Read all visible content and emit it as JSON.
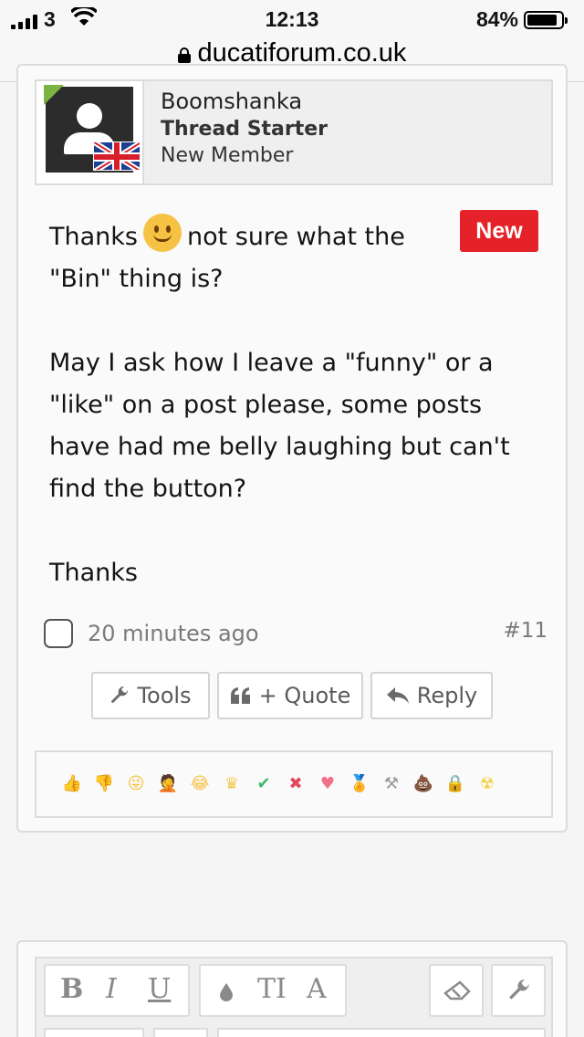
{
  "status_bar": {
    "carrier": "3",
    "time": "12:13",
    "battery": "84%"
  },
  "url_bar": {
    "domain": "ducatiforum.co.uk"
  },
  "post": {
    "author": {
      "name": "Boomshanka",
      "badge": "Thread Starter",
      "role": "New Member"
    },
    "new_badge": "New",
    "message": {
      "line1_before": "Thanks",
      "line1_after": "not sure what the",
      "line2": "\"Bin\" thing is?",
      "para2": [
        "May I ask how I leave a \"funny\" or a",
        "\"like\" on a post please, some posts",
        "have had me belly laughing but can't",
        "find the button?"
      ],
      "closing": "Thanks"
    },
    "timestamp": "20 minutes ago",
    "post_number": "#11",
    "actions": {
      "tools": "Tools",
      "quote": "+ Quote",
      "reply": "Reply"
    },
    "reactions": [
      {
        "name": "like",
        "glyph": "👍",
        "color": "#f3c9a4"
      },
      {
        "name": "dislike",
        "glyph": "👎",
        "color": "#f3c9a4"
      },
      {
        "name": "funny",
        "glyph": "😜",
        "color": "#f6c244"
      },
      {
        "name": "facepalm",
        "glyph": "🤦",
        "color": "#e8b79a"
      },
      {
        "name": "laugh",
        "glyph": "😂",
        "color": "#f6c244"
      },
      {
        "name": "winner",
        "glyph": "♛",
        "color": "#f2c94c"
      },
      {
        "name": "agree",
        "glyph": "✔",
        "color": "#3dbb6a"
      },
      {
        "name": "disagree",
        "glyph": "✖",
        "color": "#e5485c"
      },
      {
        "name": "love",
        "glyph": "♥",
        "color": "#f06f8a"
      },
      {
        "name": "medal",
        "glyph": "🏅",
        "color": "#e9b64a"
      },
      {
        "name": "useful",
        "glyph": "⚒",
        "color": "#9a9a9a"
      },
      {
        "name": "poop",
        "glyph": "💩",
        "color": "#8a5a3c"
      },
      {
        "name": "locked",
        "glyph": "🔒",
        "color": "#f0a828"
      },
      {
        "name": "radioactive",
        "glyph": "☢",
        "color": "#f4d03f"
      }
    ]
  },
  "editor": {
    "bold": "B",
    "italic": "I",
    "underline": "U",
    "text_size": "TI",
    "font": "A"
  }
}
